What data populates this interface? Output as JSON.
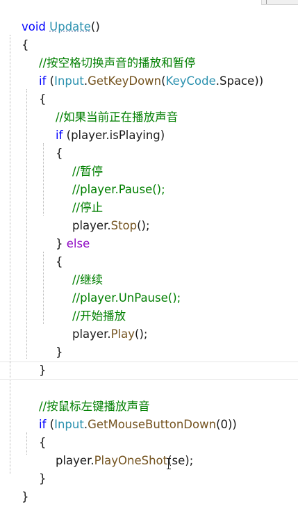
{
  "code": {
    "l1": {
      "kw": "void",
      "name": "Update",
      "paren": "()"
    },
    "l2": "{",
    "l3": "//按空格切换声音的播放和暂停",
    "l4": {
      "kw": "if",
      "p1": " (",
      "cls": "Input",
      "dot": ".",
      "fn": "GetKeyDown",
      "p2": "(",
      "type": "KeyCode",
      "dot2": ".",
      "member": "Space",
      "p3": "))"
    },
    "l5": "{",
    "l6": "//如果当前正在播放声音",
    "l7": {
      "kw": "if",
      "expr": " (player.isPlaying)"
    },
    "l8": "{",
    "l9": "//暂停",
    "l10": {
      "pre": "//player.",
      "fn": "Pause",
      "post": "();"
    },
    "l11": "//停止",
    "l12": {
      "pre": "player.",
      "fn": "Stop",
      "post": "();"
    },
    "l13": {
      "brace": "} ",
      "kw": "else"
    },
    "l14": "{",
    "l15": "//继续",
    "l16": {
      "pre": "//player.",
      "fn": "UnPause",
      "post": "();"
    },
    "l17": "//开始播放",
    "l18": {
      "pre": "player.",
      "fn": "Play",
      "post": "();"
    },
    "l19": "}",
    "l20": "}",
    "l21": "//按鼠标左键播放声音",
    "l22": {
      "kw": "if",
      "p1": " (",
      "cls": "Input",
      "dot": ".",
      "fn": "GetMouseButtonDown",
      "post": "(0))"
    },
    "l23": "{",
    "l24": {
      "pre": "player.",
      "fn": "PlayOneShot",
      "post": "(se);"
    },
    "l25": "}",
    "l26": "}"
  },
  "colors": {
    "keyword": "#0000ff",
    "else_keyword": "#8f08c4",
    "comment": "#007f00",
    "type": "#2b91af",
    "method": "#74531f",
    "text": "#1a1a1a"
  },
  "icons": {
    "cursor": "i-beam-cursor-icon"
  }
}
